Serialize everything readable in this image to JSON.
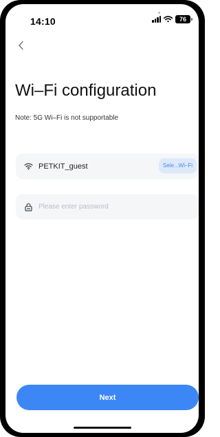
{
  "status_bar": {
    "time": "14:10",
    "battery": "76",
    "signal_icon": "cellular-signal-icon",
    "wifi_icon": "wifi-icon"
  },
  "nav": {
    "back_icon": "chevron-left-icon"
  },
  "title": "Wi–Fi configuration",
  "note": "Note: 5G Wi–Fi is not supportable",
  "wifi_field": {
    "icon": "wifi-icon",
    "ssid": "PETKIT_guest",
    "select_label": "Sele...Wi–Fi"
  },
  "password_field": {
    "icon": "lock-icon",
    "value": "",
    "placeholder": "Please enter password"
  },
  "next_label": "Next",
  "colors": {
    "accent": "#3c87f5",
    "select_bg": "#dde9fb",
    "select_text": "#4d86e6",
    "field_bg": "#f5f6f8"
  }
}
